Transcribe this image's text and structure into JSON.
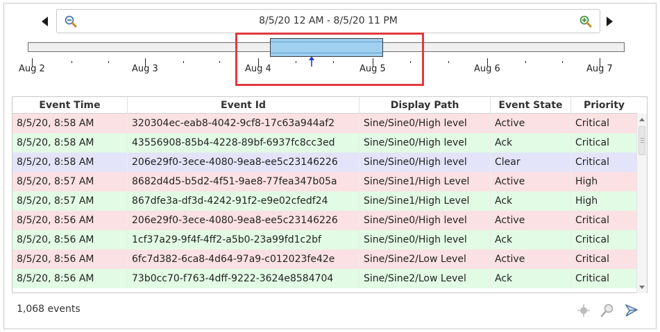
{
  "range": {
    "label": "8/5/20 12 AM - 8/5/20 11 PM",
    "zoom_out_icon": "zoom-out-icon",
    "zoom_in_icon": "zoom-in-icon",
    "prev_icon": "triangle-left-icon",
    "next_icon": "triangle-right-icon"
  },
  "timeline": {
    "labels": [
      "Aug 2",
      "Aug 3",
      "Aug 4",
      "Aug 5",
      "Aug 6",
      "Aug 7"
    ],
    "selection_start": "Aug 4",
    "selection_end": "Aug 5",
    "marker_icon": "arrow-up-icon",
    "highlight_color": "#e0393e",
    "selection_color": "#9fd0ef"
  },
  "table": {
    "columns": [
      "Event Time",
      "Event Id",
      "Display Path",
      "Event State",
      "Priority"
    ],
    "rows": [
      {
        "time": "8/5/20, 8:58 AM",
        "id": "320304ec-eab8-4042-9cf8-17c63a944af2",
        "path": "Sine/Sine0/High level",
        "state": "Active",
        "priority": "Critical"
      },
      {
        "time": "8/5/20, 8:58 AM",
        "id": "43556908-85b4-4228-89bf-6937fc8cc3ed",
        "path": "Sine/Sine0/High level",
        "state": "Ack",
        "priority": "Critical"
      },
      {
        "time": "8/5/20, 8:58 AM",
        "id": "206e29f0-3ece-4080-9ea8-ee5c23146226",
        "path": "Sine/Sine0/High level",
        "state": "Clear",
        "priority": "Critical"
      },
      {
        "time": "8/5/20, 8:57 AM",
        "id": "8682d4d5-b5d2-4f51-9ae8-77fea347b05a",
        "path": "Sine/Sine1/High Level",
        "state": "Active",
        "priority": "High"
      },
      {
        "time": "8/5/20, 8:57 AM",
        "id": "867dfe3a-df3d-4242-91f2-e9e02cfedf24",
        "path": "Sine/Sine1/High Level",
        "state": "Ack",
        "priority": "High"
      },
      {
        "time": "8/5/20, 8:56 AM",
        "id": "206e29f0-3ece-4080-9ea8-ee5c23146226",
        "path": "Sine/Sine0/High level",
        "state": "Active",
        "priority": "Critical"
      },
      {
        "time": "8/5/20, 8:56 AM",
        "id": "1cf37a29-9f4f-4ff2-a5b0-23a99fd1c2bf",
        "path": "Sine/Sine0/High level",
        "state": "Ack",
        "priority": "Critical"
      },
      {
        "time": "8/5/20, 8:56 AM",
        "id": "6fc7d382-6ca8-4d64-97a9-c012023fe42e",
        "path": "Sine/Sine2/Low Level",
        "state": "Active",
        "priority": "Critical"
      },
      {
        "time": "8/5/20, 8:56 AM",
        "id": "73b0cc70-f763-4dff-9222-3624e8584704",
        "path": "Sine/Sine2/Low Level",
        "state": "Ack",
        "priority": "Critical"
      }
    ],
    "state_colors": {
      "Active": "#fbe1e3",
      "Ack": "#e1fbe4",
      "Clear": "#e3e4f9"
    }
  },
  "footer": {
    "count_label": "1,068 events",
    "icons": [
      "filter-icon",
      "search-icon",
      "magic-wand-icon"
    ]
  }
}
